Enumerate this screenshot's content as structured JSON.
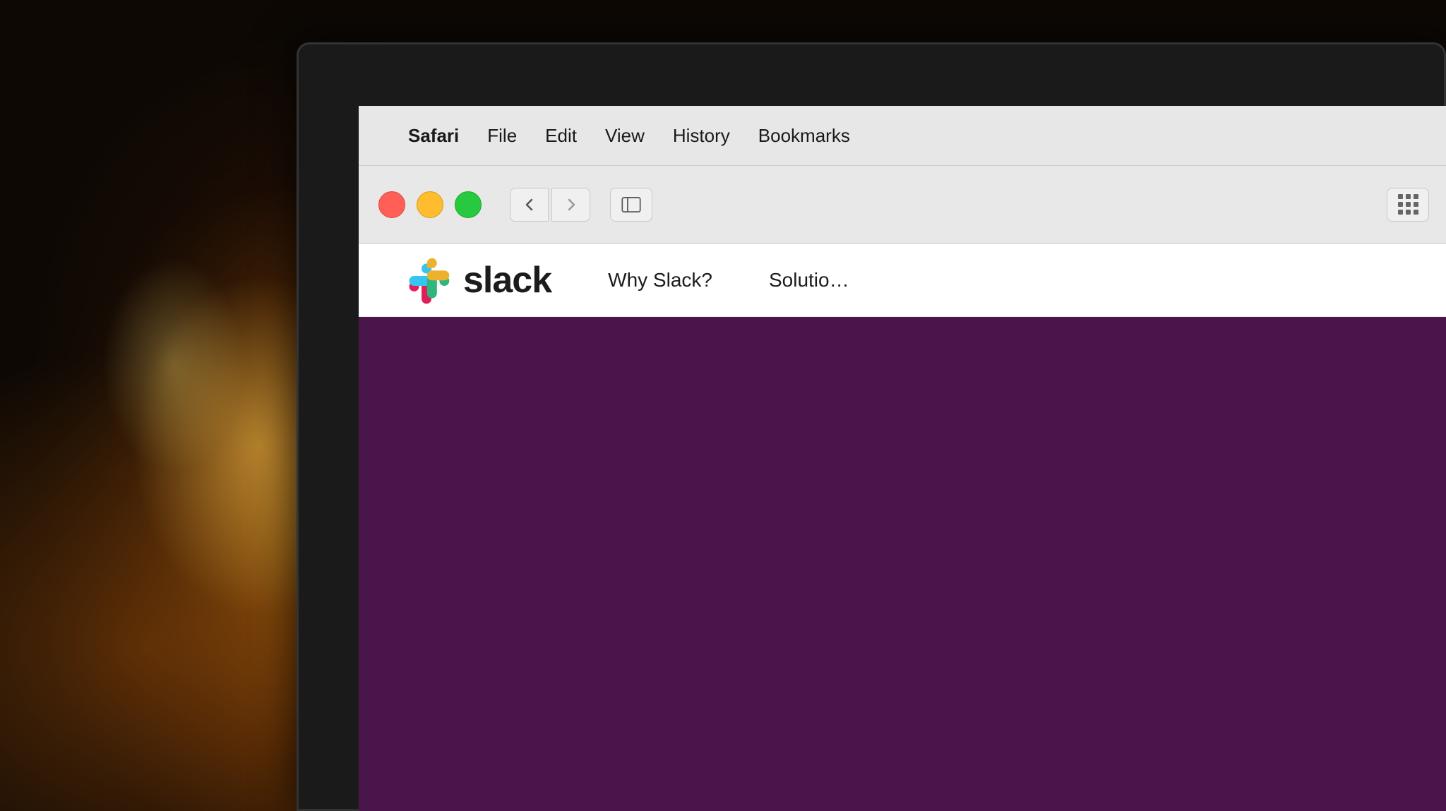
{
  "background": {
    "color": "#1a1008"
  },
  "menubar": {
    "apple_symbol": "",
    "items": [
      {
        "label": "Safari",
        "bold": true
      },
      {
        "label": "File"
      },
      {
        "label": "Edit"
      },
      {
        "label": "View"
      },
      {
        "label": "History"
      },
      {
        "label": "Bookmarks"
      }
    ]
  },
  "browser": {
    "back_label": "‹",
    "forward_label": "›",
    "traffic_lights": {
      "red_label": "",
      "yellow_label": "",
      "green_label": ""
    }
  },
  "slack": {
    "logo_text": "slack",
    "nav_links": [
      {
        "label": "Why Slack?"
      },
      {
        "label": "Solutio…"
      }
    ],
    "hero_bg": "#4a154b"
  }
}
